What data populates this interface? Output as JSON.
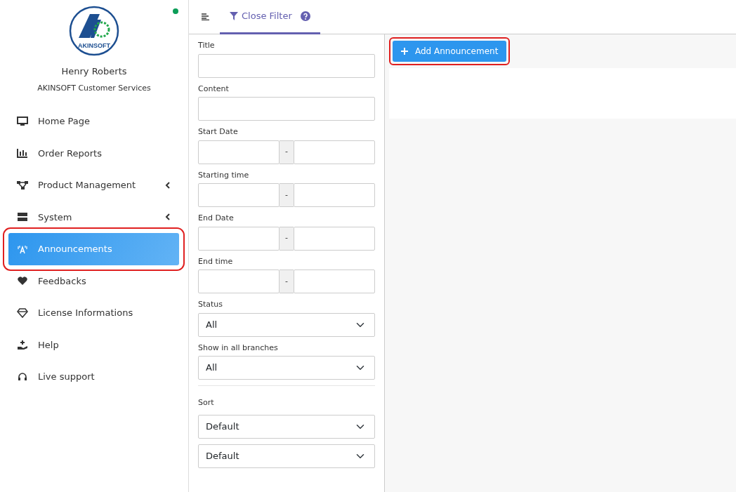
{
  "sidebar": {
    "online": true,
    "user_name": "Henry Roberts",
    "user_role": "AKINSOFT Customer Services",
    "logo_text": "AKINSOFT",
    "items": [
      {
        "label": "Home Page",
        "selected": false,
        "highlighted": false,
        "submenu": false
      },
      {
        "label": "Order Reports",
        "selected": false,
        "highlighted": false,
        "submenu": false
      },
      {
        "label": "Product Management",
        "selected": false,
        "highlighted": false,
        "submenu": true
      },
      {
        "label": "System",
        "selected": false,
        "highlighted": false,
        "submenu": true
      },
      {
        "label": "Announcements",
        "selected": true,
        "highlighted": true,
        "submenu": false
      },
      {
        "label": "Feedbacks",
        "selected": false,
        "highlighted": false,
        "submenu": false
      },
      {
        "label": "License Informations",
        "selected": false,
        "highlighted": false,
        "submenu": false
      },
      {
        "label": "Help",
        "selected": false,
        "highlighted": false,
        "submenu": false
      },
      {
        "label": "Live support",
        "selected": false,
        "highlighted": false,
        "submenu": false
      }
    ]
  },
  "toolbar": {
    "tab": {
      "label": "Close Filter",
      "selected": true
    }
  },
  "filter": {
    "fields": [
      {
        "kind": "text",
        "label": "Title"
      },
      {
        "kind": "text",
        "label": "Content"
      },
      {
        "kind": "range",
        "label": "Start Date",
        "separator": "-"
      },
      {
        "kind": "range",
        "label": "Starting time",
        "separator": "-"
      },
      {
        "kind": "range",
        "label": "End Date",
        "separator": "-"
      },
      {
        "kind": "range",
        "label": "End time",
        "separator": "-"
      },
      {
        "kind": "select",
        "label": "Status",
        "value": "All"
      },
      {
        "kind": "select",
        "label": "Show in all branches",
        "value": "All"
      }
    ],
    "sort": {
      "label": "Sort",
      "selects": [
        "Default",
        "Default"
      ]
    }
  },
  "main": {
    "add_button": {
      "label": "Add Announcement",
      "highlighted": true
    }
  }
}
